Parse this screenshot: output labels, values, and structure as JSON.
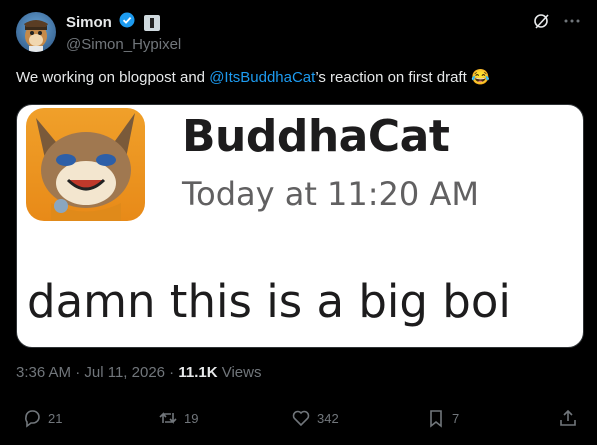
{
  "author": {
    "display_name": "Simon",
    "handle": "@Simon_Hypixel"
  },
  "tweet": {
    "text_before": "We working on blogpost and ",
    "mention": "@ItsBuddhaCat",
    "text_after": "’s reaction on first draft ",
    "emoji": "😂"
  },
  "media": {
    "slack_name": "BuddhaCat",
    "slack_time": "Today at 11:20 AM",
    "slack_message": "damn this is a big boi"
  },
  "meta": {
    "time": "3:36 AM",
    "sep1": " · ",
    "date": "Jul 11, 2026",
    "sep2": " · ",
    "views_count": "11.1K",
    "views_label": " Views"
  },
  "actions": {
    "replies": "21",
    "reposts": "19",
    "likes": "342",
    "bookmarks": "7"
  },
  "colors": {
    "background": "#000000",
    "accent": "#1d9bf0",
    "muted": "#71767b",
    "text": "#e7e9ea"
  }
}
